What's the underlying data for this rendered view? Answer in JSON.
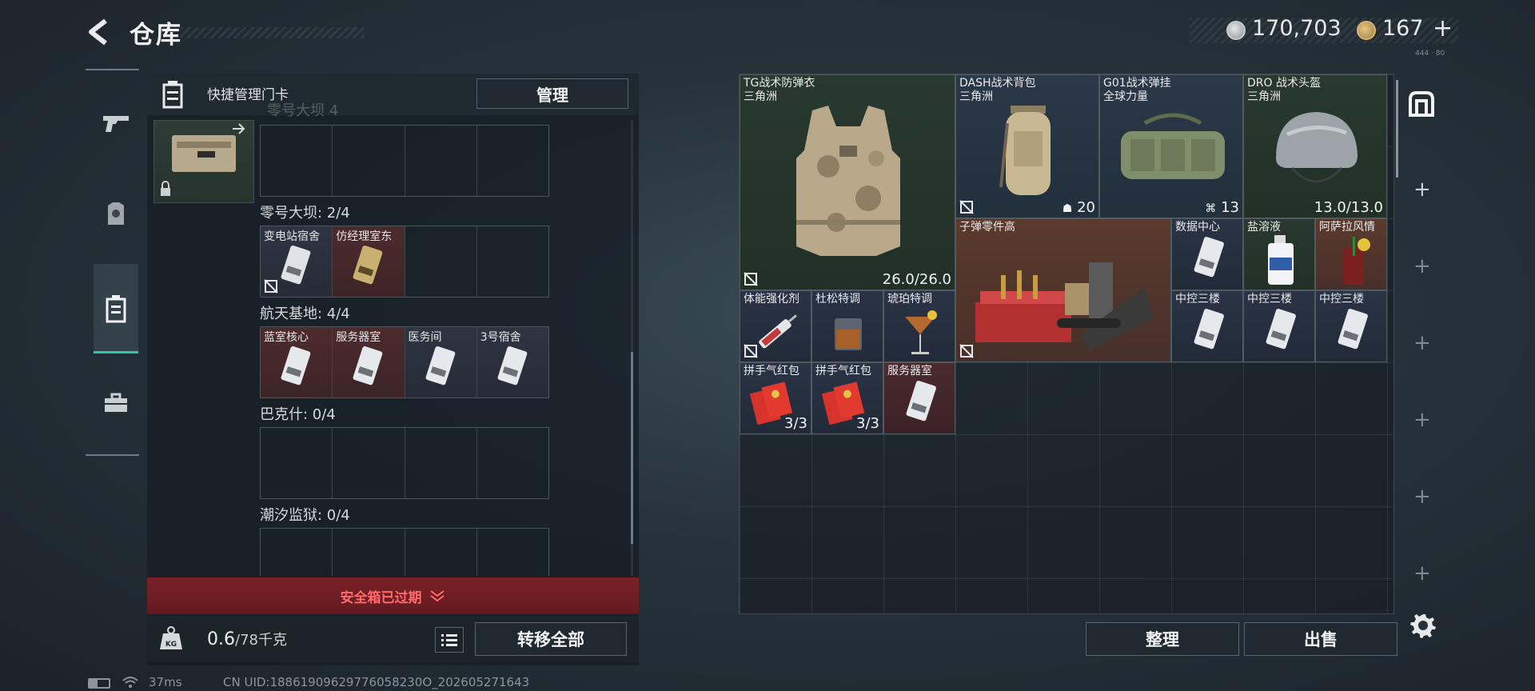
{
  "header": {
    "title": "仓库",
    "currency_silver": "170,703",
    "currency_gold": "167",
    "plus": "+",
    "tiny_mark": "444 · 80"
  },
  "left_nav": {
    "items": [
      "gun-icon",
      "armor-icon",
      "keycard-case-icon",
      "toolbox-icon"
    ],
    "active": "keycard-case-icon"
  },
  "keycard_panel": {
    "title": "快捷管理门卡",
    "manage_label": "管理",
    "faded_label": "零号大坝 4",
    "sections": [
      {
        "label": "",
        "slots": [
          "",
          "",
          "",
          ""
        ]
      },
      {
        "label": "零号大坝: 2/4",
        "slots": [
          "变电站宿舍",
          "仿经理室东",
          "",
          ""
        ]
      },
      {
        "label": "航天基地: 4/4",
        "slots": [
          "蓝室核心",
          "服务器室",
          "医务间",
          "3号宿舍"
        ]
      },
      {
        "label": "巴克什: 0/4",
        "slots": [
          "",
          "",
          "",
          ""
        ]
      },
      {
        "label": "潮汐监狱: 0/4",
        "slots": [
          "",
          "",
          "",
          ""
        ]
      }
    ],
    "expired_label": "安全箱已过期",
    "weight": "0.6",
    "weight_max": "/78千克",
    "transfer_label": "转移全部"
  },
  "stash": {
    "items": [
      {
        "name": "TG战术防弹衣",
        "sub": "三角洲",
        "value": "26.0/26.0"
      },
      {
        "name": "DASH战术背包",
        "sub": "三角洲",
        "value": "20"
      },
      {
        "name": "G01战术弹挂",
        "sub": "全球力量",
        "value": "13"
      },
      {
        "name": "DRO 战术头盔",
        "sub": "三角洲",
        "value": "13.0/13.0"
      },
      {
        "name": "子弹零件高",
        "sub": "",
        "value": ""
      },
      {
        "name": "数据中心",
        "sub": "",
        "value": ""
      },
      {
        "name": "盐溶液",
        "sub": "",
        "value": ""
      },
      {
        "name": "阿萨拉风情",
        "sub": "",
        "value": ""
      },
      {
        "name": "体能强化剂",
        "sub": "",
        "value": ""
      },
      {
        "name": "杜松特调",
        "sub": "",
        "value": ""
      },
      {
        "name": "琥珀特调",
        "sub": "",
        "value": ""
      },
      {
        "name": "中控三楼",
        "sub": "",
        "value": ""
      },
      {
        "name": "中控三楼",
        "sub": "",
        "value": ""
      },
      {
        "name": "中控三楼",
        "sub": "",
        "value": ""
      },
      {
        "name": "拼手气红包",
        "sub": "",
        "value": "3/3"
      },
      {
        "name": "拼手气红包",
        "sub": "",
        "value": "3/3"
      },
      {
        "name": "服务器室",
        "sub": "",
        "value": ""
      }
    ],
    "sort_label": "整理",
    "sell_label": "出售"
  },
  "status": {
    "ping": "37ms",
    "uid": "CN UID:18861909629776058230O_202605271643"
  },
  "colors": {
    "accent": "#2ec7a1",
    "expired": "#ff6a6a",
    "expired_bg": "#7a2127"
  }
}
